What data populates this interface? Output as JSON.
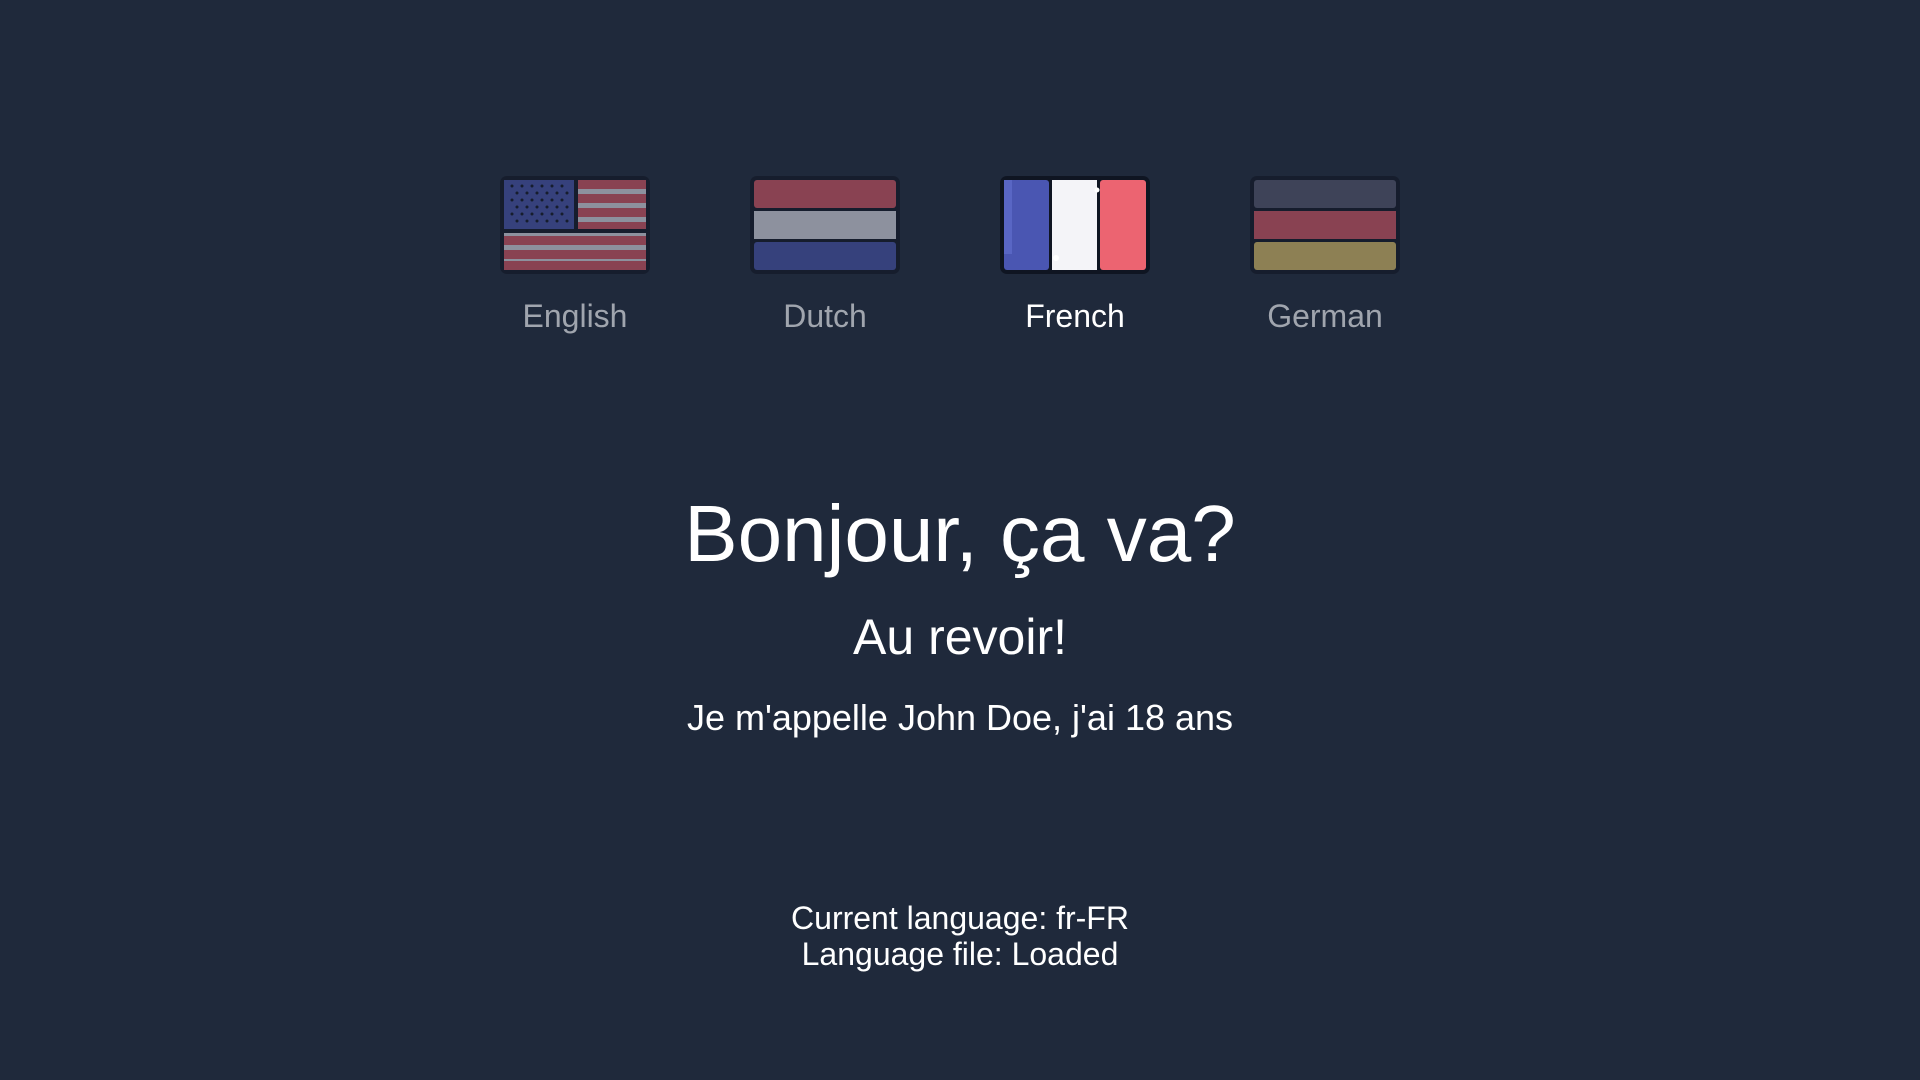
{
  "languages": [
    {
      "label": "English",
      "flag": "us-flag-icon",
      "active": false
    },
    {
      "label": "Dutch",
      "flag": "netherlands-flag-icon",
      "active": false
    },
    {
      "label": "French",
      "flag": "france-flag-icon",
      "active": true
    },
    {
      "label": "German",
      "flag": "germany-flag-icon",
      "active": false
    }
  ],
  "content": {
    "greeting": "Bonjour, ça va?",
    "farewell": "Au revoir!",
    "intro": "Je m'appelle John Doe, j'ai 18 ans"
  },
  "status": {
    "current_language": "Current language: fr-FR",
    "language_file": "Language file: Loaded"
  },
  "colors": {
    "background": "#1f293b",
    "text_active": "#ffffff",
    "text_inactive": "#a0a5ae"
  }
}
